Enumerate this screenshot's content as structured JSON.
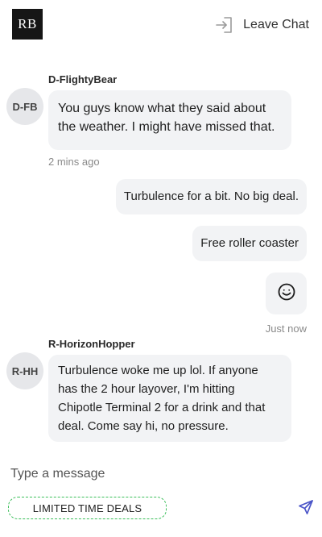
{
  "header": {
    "logo_text": "RB",
    "leave_label": "Leave Chat",
    "leave_icon": "exit-door-icon"
  },
  "messages": {
    "m1": {
      "sender": "D-FlightyBear",
      "avatar": "D-FB",
      "lines": [
        "You guys know what they said about",
        "the weather. I might have missed that."
      ],
      "time": "2 mins ago"
    },
    "m2": {
      "text": "Turbulence for a bit. No big deal."
    },
    "m3": {
      "text": "Free roller coaster"
    },
    "m4": {
      "emoji": "smiley-face-icon",
      "time": "Just now"
    },
    "m5": {
      "sender": "R-HorizonHopper",
      "avatar": "R-HH",
      "lines": [
        "Turbulence woke me up lol. If anyone",
        "has the 2 hour layover, I'm hitting",
        "Chipotle Terminal 2 for a drink and that",
        "deal. Come say hi, no pressure."
      ]
    }
  },
  "composer": {
    "placeholder": "Type a message",
    "deals_label": "LIMITED TIME DEALS",
    "send_icon": "send-icon",
    "deals_border_color": "#3bbf5a"
  }
}
